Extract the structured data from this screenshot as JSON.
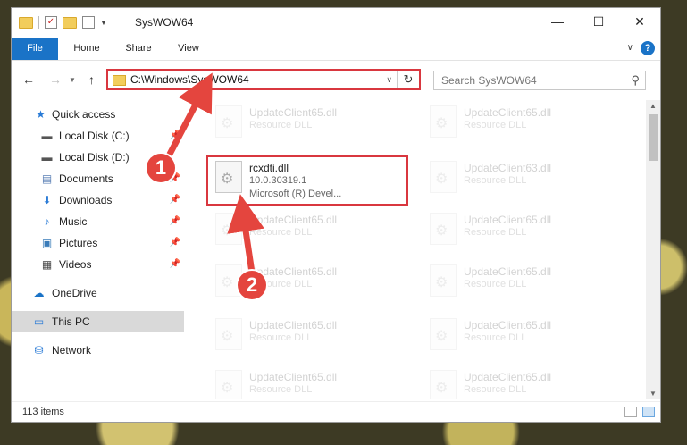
{
  "window": {
    "title": "SysWOW64",
    "controls": {
      "minimize": "—",
      "maximize": "☐",
      "close": "✕"
    }
  },
  "ribbon": {
    "tabs": [
      "File",
      "Home",
      "Share",
      "View"
    ],
    "help": "?"
  },
  "nav": {
    "address": "C:\\Windows\\SysWOW64",
    "search_placeholder": "Search SysWOW64"
  },
  "sidebar": {
    "items": [
      {
        "label": "Quick access",
        "icon": "star-icon"
      },
      {
        "label": "Local Disk (C:)",
        "icon": "drive-icon",
        "pinned": true
      },
      {
        "label": "Local Disk (D:)",
        "icon": "drive-icon"
      },
      {
        "label": "Documents",
        "icon": "documents-icon",
        "pinned": true
      },
      {
        "label": "Downloads",
        "icon": "download-icon",
        "pinned": true
      },
      {
        "label": "Music",
        "icon": "music-icon",
        "pinned": true
      },
      {
        "label": "Pictures",
        "icon": "pictures-icon",
        "pinned": true
      },
      {
        "label": "Videos",
        "icon": "videos-icon",
        "pinned": true
      },
      {
        "label": "OneDrive",
        "icon": "cloud-icon"
      },
      {
        "label": "This PC",
        "icon": "computer-icon",
        "selected": true
      },
      {
        "label": "Network",
        "icon": "network-icon"
      }
    ]
  },
  "files": {
    "faded": [
      {
        "name": "UpdateClient65.dll",
        "desc": "Resource DLL"
      },
      {
        "name": "UpdateClient65.dll",
        "desc": "Resource DLL"
      },
      {
        "name": "UpdateClient63.dll",
        "desc": "Resource DLL"
      },
      {
        "name": "UpdateClient65.dll",
        "desc": "Resource DLL"
      },
      {
        "name": "UpdateClient65.dll",
        "desc": "Resource DLL"
      },
      {
        "name": "UpdateClient65.dll",
        "desc": "Resource DLL"
      },
      {
        "name": "UpdateClient65.dll",
        "desc": "Resource DLL"
      },
      {
        "name": "UpdateClient65.dll",
        "desc": "Resource DLL"
      },
      {
        "name": "UpdateClient65.dll",
        "desc": "Resource DLL"
      },
      {
        "name": "UpdateClient65.dll",
        "desc": "Resource DLL"
      },
      {
        "name": "UpdateClient65.dll",
        "desc": "Resource DLL"
      }
    ],
    "highlighted": {
      "name": "rcxdti.dll",
      "version": "10.0.30319.1",
      "company": "Microsoft (R) Devel..."
    }
  },
  "status": {
    "item_count": "113 items"
  },
  "annotations": {
    "step1": "1",
    "step2": "2",
    "color": "#e4453e"
  }
}
